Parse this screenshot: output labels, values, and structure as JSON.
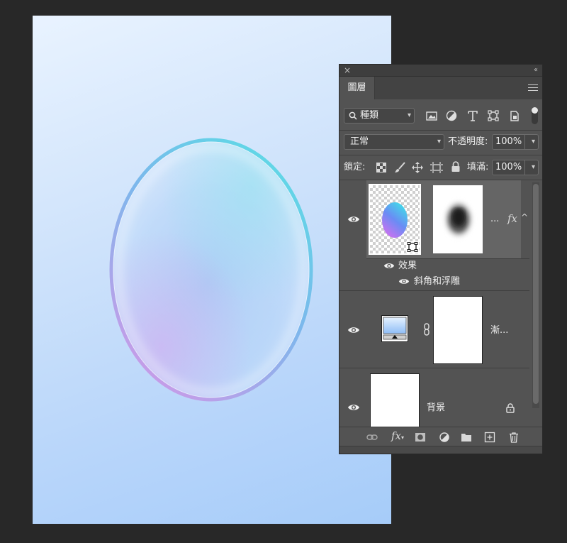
{
  "panel": {
    "close_glyph": "×",
    "collapse_glyph": "‹‹",
    "tab_label": "圖層",
    "filter": {
      "kind_label": "種類",
      "icons": [
        "image-filter-icon",
        "adjustment-filter-icon",
        "type-filter-icon",
        "shape-filter-icon",
        "smart-object-filter-icon"
      ]
    },
    "blend": {
      "mode": "正常",
      "opacity_label": "不透明度:",
      "opacity_value": "100%"
    },
    "lock": {
      "label": "鎖定:",
      "fill_label": "填滿:",
      "fill_value": "100%"
    },
    "layers": [
      {
        "name": "...",
        "fx": "fx",
        "selected": true,
        "effects_label": "效果",
        "effect_items": [
          "斜角和浮雕"
        ]
      },
      {
        "name": "漸..."
      },
      {
        "name": "背景",
        "locked": true
      }
    ],
    "bottom_icons": [
      "link-icon",
      "fx-icon",
      "mask-icon",
      "adjustment-icon",
      "folder-icon",
      "new-layer-icon",
      "trash-icon"
    ]
  },
  "colors": {
    "panel_bg": "#535353",
    "canvas_top": "#e9f3ff",
    "canvas_bottom": "#a6ccf9",
    "bubble_cyan": "#5fd8e6",
    "bubble_purple": "#c89be8"
  }
}
